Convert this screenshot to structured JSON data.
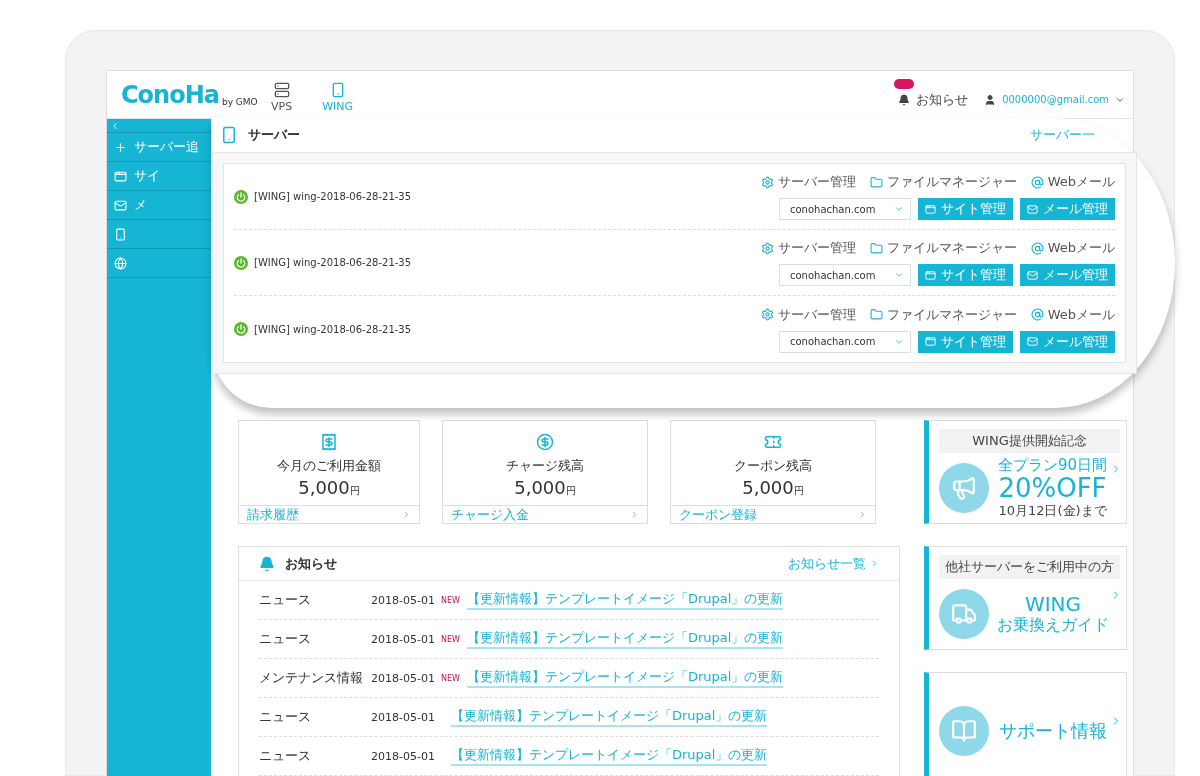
{
  "header": {
    "logo": "ConoHa",
    "logo_sub": "by GMO",
    "nav": [
      {
        "label": "VPS",
        "kind": "server",
        "selected": false
      },
      {
        "label": "WING",
        "kind": "wing",
        "selected": true
      }
    ],
    "notices": "お知らせ",
    "account": "0000000@gmail.com"
  },
  "sidebar": {
    "items": [
      {
        "kind": "plus",
        "label": "サーバー追"
      },
      {
        "kind": "window",
        "label": "サイ"
      },
      {
        "kind": "mail",
        "label": "メ"
      },
      {
        "kind": "wing"
      },
      {
        "kind": "globe"
      }
    ]
  },
  "server_panel": {
    "title": "サーバー",
    "link": "サーバー一",
    "servers": [
      {
        "name": "[WING] wing-2018-06-28-21-35",
        "running": true,
        "actions": [
          "サーバー管理",
          "ファイルマネージャー",
          "Webメール"
        ],
        "domain": "conohachan.com",
        "buttons": [
          "サイト管理",
          "メール管理"
        ]
      },
      {
        "name": "[WING] wing-2018-06-28-21-35",
        "running": true,
        "actions": [
          "サーバー管理",
          "ファイルマネージャー",
          "Webメール"
        ],
        "domain": "conohachan.com",
        "buttons": [
          "サイト管理",
          "メール管理"
        ]
      },
      {
        "name": "[WING] wing-2018-06-28-21-35",
        "running": true,
        "actions": [
          "サーバー管理",
          "ファイルマネージャー",
          "Webメール"
        ],
        "domain": "conohachan.com",
        "buttons": [
          "サイト管理",
          "メール管理"
        ]
      }
    ]
  },
  "stats": [
    {
      "kind": "invoice",
      "label": "今月のご利用金額",
      "amount": "5,000",
      "unit": "円",
      "link": "請求履歴"
    },
    {
      "kind": "dollar",
      "label": "チャージ残高",
      "amount": "5,000",
      "unit": "円",
      "link": "チャージ入金"
    },
    {
      "kind": "coupon",
      "label": "クーポン残高",
      "amount": "5,000",
      "unit": "円",
      "link": "クーポン登録"
    }
  ],
  "news": {
    "title": "お知らせ",
    "more": "お知らせ一覧",
    "items": [
      {
        "category": "ニュース",
        "date": "2018-05-01",
        "badge": "NEW",
        "title": "【更新情報】テンプレートイメージ「Drupal」の更新"
      },
      {
        "category": "ニュース",
        "date": "2018-05-01",
        "badge": "NEW",
        "title": "【更新情報】テンプレートイメージ「Drupal」の更新"
      },
      {
        "category": "メンテナンス情報",
        "date": "2018-05-01",
        "badge": "NEW",
        "title": "【更新情報】テンプレートイメージ「Drupal」の更新"
      },
      {
        "category": "ニュース",
        "date": "2018-05-01",
        "title": "【更新情報】テンプレートイメージ「Drupal」の更新"
      },
      {
        "category": "ニュース",
        "date": "2018-05-01",
        "title": "【更新情報】テンプレートイメージ「Drupal」の更新"
      }
    ]
  },
  "banners": [
    {
      "kind": "campaign",
      "caption": "WING提供開始記念",
      "lines": [
        "全プラン90日間",
        "20%OFF",
        "10月12日(金)まで"
      ]
    },
    {
      "kind": "migration",
      "caption": "他社サーバーをご利用中の方",
      "lines": [
        "WING",
        "お乗換えガイド"
      ]
    },
    {
      "kind": "support",
      "lines": [
        "サポート情報"
      ]
    }
  ]
}
